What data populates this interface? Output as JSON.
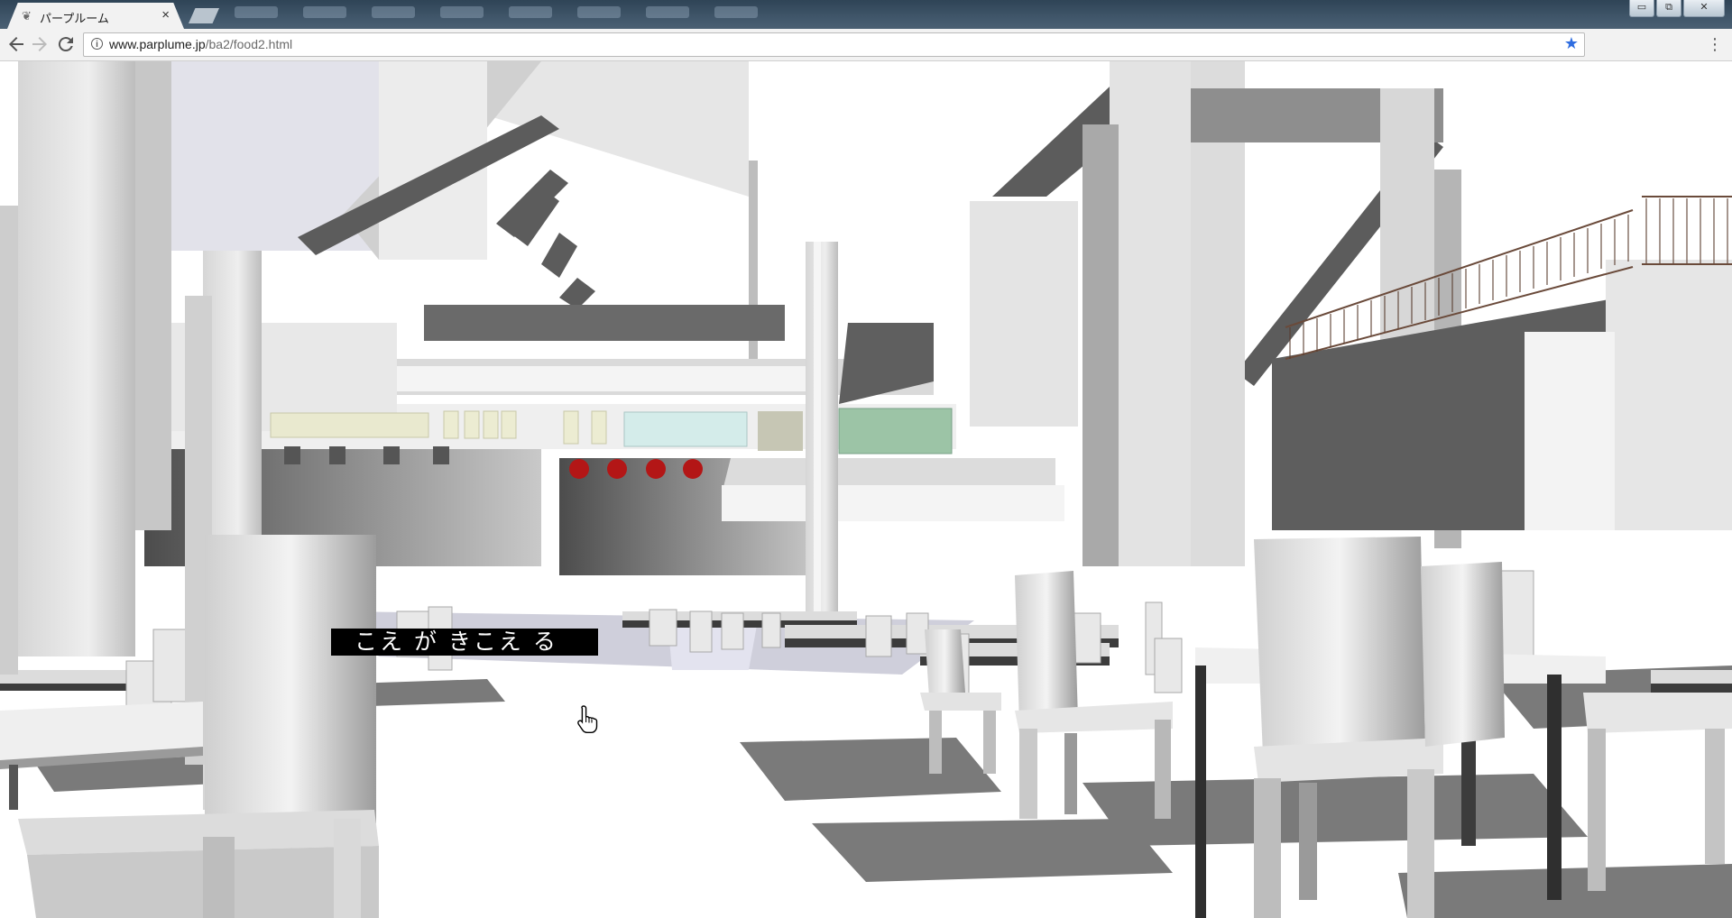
{
  "browser": {
    "tab": {
      "title": "パープルーム",
      "close": "×"
    },
    "url": {
      "host": "www.parplume.jp",
      "path": "/ba2/food2.html"
    },
    "window_controls": {
      "minimize": "▭",
      "maximize": "⧉",
      "close": "✕"
    }
  },
  "scene": {
    "subtitle": "こえ が きこえ る"
  },
  "colors": {
    "tab_strip": "#3e5366",
    "toolbar": "#f2f2f2",
    "bookmark_star": "#2f6de0",
    "subtitle_bg": "#000000",
    "lantern_red": "#b01818"
  },
  "icons": {
    "back": "back-arrow-icon",
    "forward": "forward-arrow-icon",
    "reload": "reload-icon",
    "info": "info-icon",
    "bookmark": "star-icon",
    "menu": "kebab-menu-icon"
  }
}
